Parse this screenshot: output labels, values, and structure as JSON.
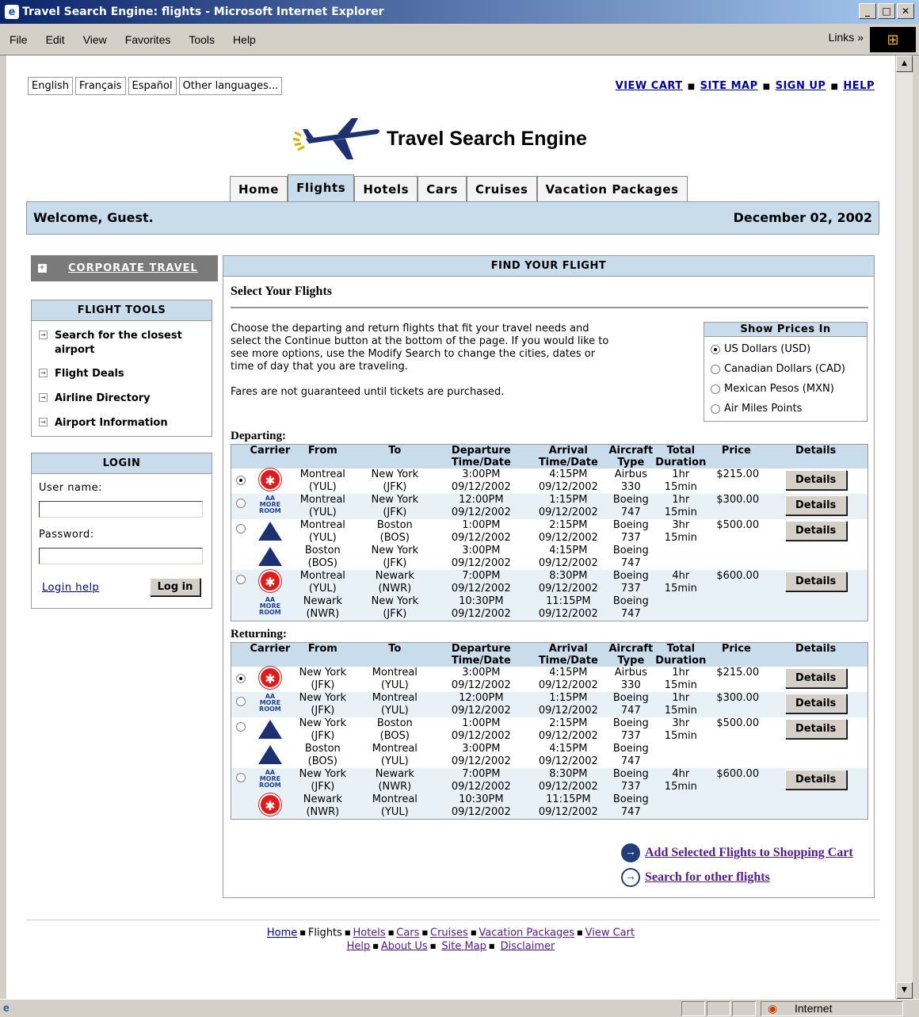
{
  "window": {
    "title": "Travel Search Engine: flights - Microsoft Internet Explorer"
  },
  "menu": [
    "File",
    "Edit",
    "View",
    "Favorites",
    "Tools",
    "Help"
  ],
  "links_label": "Links",
  "status": {
    "zone": "Internet"
  },
  "languages": [
    "English",
    "Français",
    "Español",
    "Other languages..."
  ],
  "toplinks": {
    "view_cart": "VIEW CART",
    "site_map": "SITE MAP",
    "sign_up": "SIGN UP",
    "help": "HELP"
  },
  "brand": {
    "name": "Travel Search Engine"
  },
  "tabs": [
    "Home",
    "Flights",
    "Hotels",
    "Cars",
    "Cruises",
    "Vacation Packages"
  ],
  "active_tab": "Flights",
  "welcome": {
    "text": "Welcome, Guest.",
    "date": "December 02, 2002"
  },
  "corporate": "CORPORATE TRAVEL",
  "flight_tools": {
    "title": "FLIGHT TOOLS",
    "items": [
      "Search for the closest airport",
      "Flight Deals",
      "Airline Directory",
      "Airport Information"
    ]
  },
  "login": {
    "title": "LOGIN",
    "user_label": "User name:",
    "password_label": "Password:",
    "help": "Login help",
    "button": "Log in"
  },
  "find": {
    "title": "FIND YOUR FLIGHT",
    "subtitle": "Select Your Flights",
    "intro": "Choose the departing and return flights that fit your travel needs and select the Continue button at the bottom of the page. If you would like to see more options, use the Modify Search to change the cities, dates or time of day that you are traveling.",
    "disclaimer": "Fares are not guaranteed until tickets are purchased."
  },
  "prices": {
    "title": "Show Prices In",
    "options": [
      "US Dollars (USD)",
      "Canadian Dollars (CAD)",
      "Mexican Pesos (MXN)",
      "Air Miles Points"
    ],
    "selected": 0
  },
  "columns": {
    "carrier": "Carrier",
    "from": "From",
    "to": "To",
    "dep1": "Departure",
    "dep2": "Time/Date",
    "arr1": "Arrival",
    "arr2": "Time/Date",
    "air1": "Aircraft",
    "air2": "Type",
    "dur1": "Total",
    "dur2": "Duration",
    "price": "Price",
    "details": "Details"
  },
  "departing": {
    "label": "Departing:",
    "flights": [
      {
        "selected": true,
        "legs": [
          {
            "carrier": "ac-icon",
            "from": [
              "Montreal",
              "(YUL)"
            ],
            "to": [
              "New York",
              "(JFK)"
            ],
            "dep": [
              "3:00PM",
              "09/12/2002"
            ],
            "arr": [
              "4:15PM",
              "09/12/2002"
            ],
            "aircraft": [
              "Airbus",
              "330"
            ]
          }
        ],
        "duration": [
          "1hr",
          "15min"
        ],
        "price": "$215.00",
        "details": "Details"
      },
      {
        "selected": false,
        "legs": [
          {
            "carrier": "aa-icon",
            "from": [
              "Montreal",
              "(YUL)"
            ],
            "to": [
              "New York",
              "(JFK)"
            ],
            "dep": [
              "12:00PM",
              "09/12/2002"
            ],
            "arr": [
              "1:15PM",
              "09/12/2002"
            ],
            "aircraft": [
              "Boeing",
              "747"
            ]
          }
        ],
        "duration": [
          "1hr",
          "15min"
        ],
        "price": "$300.00",
        "details": "Details"
      },
      {
        "selected": false,
        "legs": [
          {
            "carrier": "delta-icon",
            "from": [
              "Montreal",
              "(YUL)"
            ],
            "to": [
              "Boston",
              "(BOS)"
            ],
            "dep": [
              "1:00PM",
              "09/12/2002"
            ],
            "arr": [
              "2:15PM",
              "09/12/2002"
            ],
            "aircraft": [
              "Boeing",
              "737"
            ]
          },
          {
            "carrier": "delta-icon",
            "from": [
              "Boston",
              "(BOS)"
            ],
            "to": [
              "New York",
              "(JFK)"
            ],
            "dep": [
              "3:00PM",
              "09/12/2002"
            ],
            "arr": [
              "4:15PM",
              "09/12/2002"
            ],
            "aircraft": [
              "Boeing",
              "747"
            ]
          }
        ],
        "duration": [
          "3hr",
          "15min"
        ],
        "price": "$500.00",
        "details": "Details"
      },
      {
        "selected": false,
        "legs": [
          {
            "carrier": "ac-icon",
            "from": [
              "Montreal",
              "(YUL)"
            ],
            "to": [
              "Newark",
              "(NWR)"
            ],
            "dep": [
              "7:00PM",
              "09/12/2002"
            ],
            "arr": [
              "8:30PM",
              "09/12/2002"
            ],
            "aircraft": [
              "Boeing",
              "737"
            ]
          },
          {
            "carrier": "aa-icon",
            "from": [
              "Newark",
              "(NWR)"
            ],
            "to": [
              "New York",
              "(JFK)"
            ],
            "dep": [
              "10:30PM",
              "09/12/2002"
            ],
            "arr": [
              "11:15PM",
              "09/12/2002"
            ],
            "aircraft": [
              "Boeing",
              "747"
            ]
          }
        ],
        "duration": [
          "4hr",
          "15min"
        ],
        "price": "$600.00",
        "details": "Details"
      }
    ]
  },
  "returning": {
    "label": "Returning:",
    "flights": [
      {
        "selected": true,
        "legs": [
          {
            "carrier": "ac-icon",
            "from": [
              "New York",
              "(JFK)"
            ],
            "to": [
              "Montreal",
              "(YUL)"
            ],
            "dep": [
              "3:00PM",
              "09/12/2002"
            ],
            "arr": [
              "4:15PM",
              "09/12/2002"
            ],
            "aircraft": [
              "Airbus",
              "330"
            ]
          }
        ],
        "duration": [
          "1hr",
          "15min"
        ],
        "price": "$215.00",
        "details": "Details"
      },
      {
        "selected": false,
        "legs": [
          {
            "carrier": "aa-icon",
            "from": [
              "New York",
              "(JFK)"
            ],
            "to": [
              "Montreal",
              "(YUL)"
            ],
            "dep": [
              "12:00PM",
              "09/12/2002"
            ],
            "arr": [
              "1:15PM",
              "09/12/2002"
            ],
            "aircraft": [
              "Boeing",
              "747"
            ]
          }
        ],
        "duration": [
          "1hr",
          "15min"
        ],
        "price": "$300.00",
        "details": "Details"
      },
      {
        "selected": false,
        "legs": [
          {
            "carrier": "delta-icon",
            "from": [
              "New York",
              "(JFK)"
            ],
            "to": [
              "Boston",
              "(BOS)"
            ],
            "dep": [
              "1:00PM",
              "09/12/2002"
            ],
            "arr": [
              "2:15PM",
              "09/12/2002"
            ],
            "aircraft": [
              "Boeing",
              "737"
            ]
          },
          {
            "carrier": "delta-icon",
            "from": [
              "Boston",
              "(BOS)"
            ],
            "to": [
              "Montreal",
              "(YUL)"
            ],
            "dep": [
              "3:00PM",
              "09/12/2002"
            ],
            "arr": [
              "4:15PM",
              "09/12/2002"
            ],
            "aircraft": [
              "Boeing",
              "747"
            ]
          }
        ],
        "duration": [
          "3hr",
          "15min"
        ],
        "price": "$500.00",
        "details": "Details"
      },
      {
        "selected": false,
        "legs": [
          {
            "carrier": "aa-icon",
            "from": [
              "New York",
              "(JFK)"
            ],
            "to": [
              "Newark",
              "(NWR)"
            ],
            "dep": [
              "7:00PM",
              "09/12/2002"
            ],
            "arr": [
              "8:30PM",
              "09/12/2002"
            ],
            "aircraft": [
              "Boeing",
              "737"
            ]
          },
          {
            "carrier": "ac-icon",
            "from": [
              "Newark",
              "(NWR)"
            ],
            "to": [
              "Montreal",
              "(YUL)"
            ],
            "dep": [
              "10:30PM",
              "09/12/2002"
            ],
            "arr": [
              "11:15PM",
              "09/12/2002"
            ],
            "aircraft": [
              "Boeing",
              "747"
            ]
          }
        ],
        "duration": [
          "4hr",
          "15min"
        ],
        "price": "$600.00",
        "details": "Details"
      }
    ]
  },
  "actions": {
    "add": "Add Selected Flights to Shopping Cart",
    "search": "Search for other flights"
  },
  "footer": {
    "row1": [
      "Home",
      "Flights",
      "Hotels",
      "Cars",
      "Cruises",
      "Vacation Packages",
      "View Cart"
    ],
    "row2": [
      "Help",
      "About Us",
      "Site Map",
      "Disclaimer"
    ]
  },
  "colors": {
    "accent": "#c9dcec",
    "link": "#00008b",
    "ac_red": "#e31a1a",
    "delta_navy": "#1d3070"
  }
}
